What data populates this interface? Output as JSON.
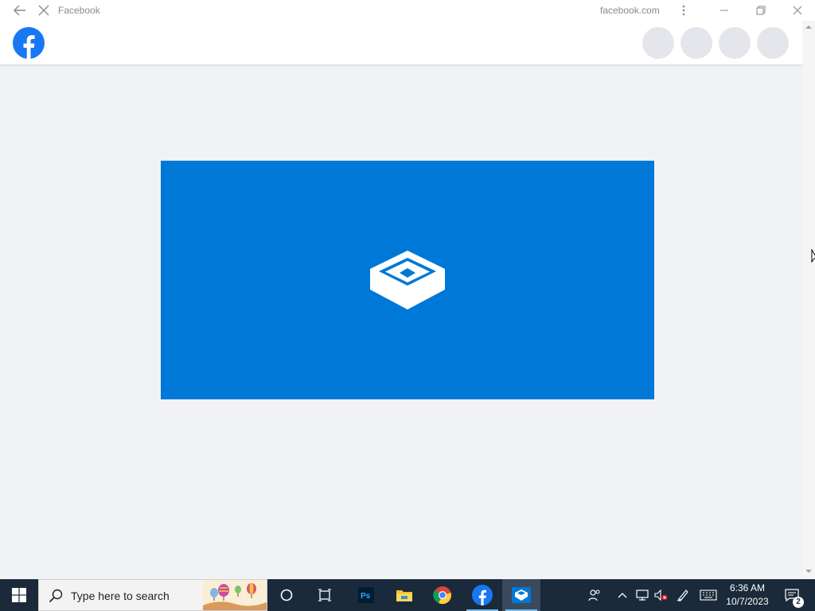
{
  "window": {
    "title": "Facebook",
    "domain": "facebook.com"
  },
  "colors": {
    "facebook_blue": "#1877f2",
    "splash_blue": "#0078d7",
    "page_background": "#f0f2f5",
    "taskbar": "#1b2a3a"
  },
  "header": {
    "logo_icon": "facebook-logo-icon",
    "action_buttons": [
      "placeholder-circle",
      "placeholder-circle",
      "placeholder-circle",
      "placeholder-circle"
    ]
  },
  "splash": {
    "icon": "app-box-icon"
  },
  "taskbar": {
    "search_placeholder": "Type here to search",
    "apps": [
      "photoshop",
      "file-explorer",
      "chrome",
      "facebook",
      "app-box"
    ],
    "clock_time": "6:36 AM",
    "clock_date": "10/7/2023",
    "notification_count": "2"
  }
}
